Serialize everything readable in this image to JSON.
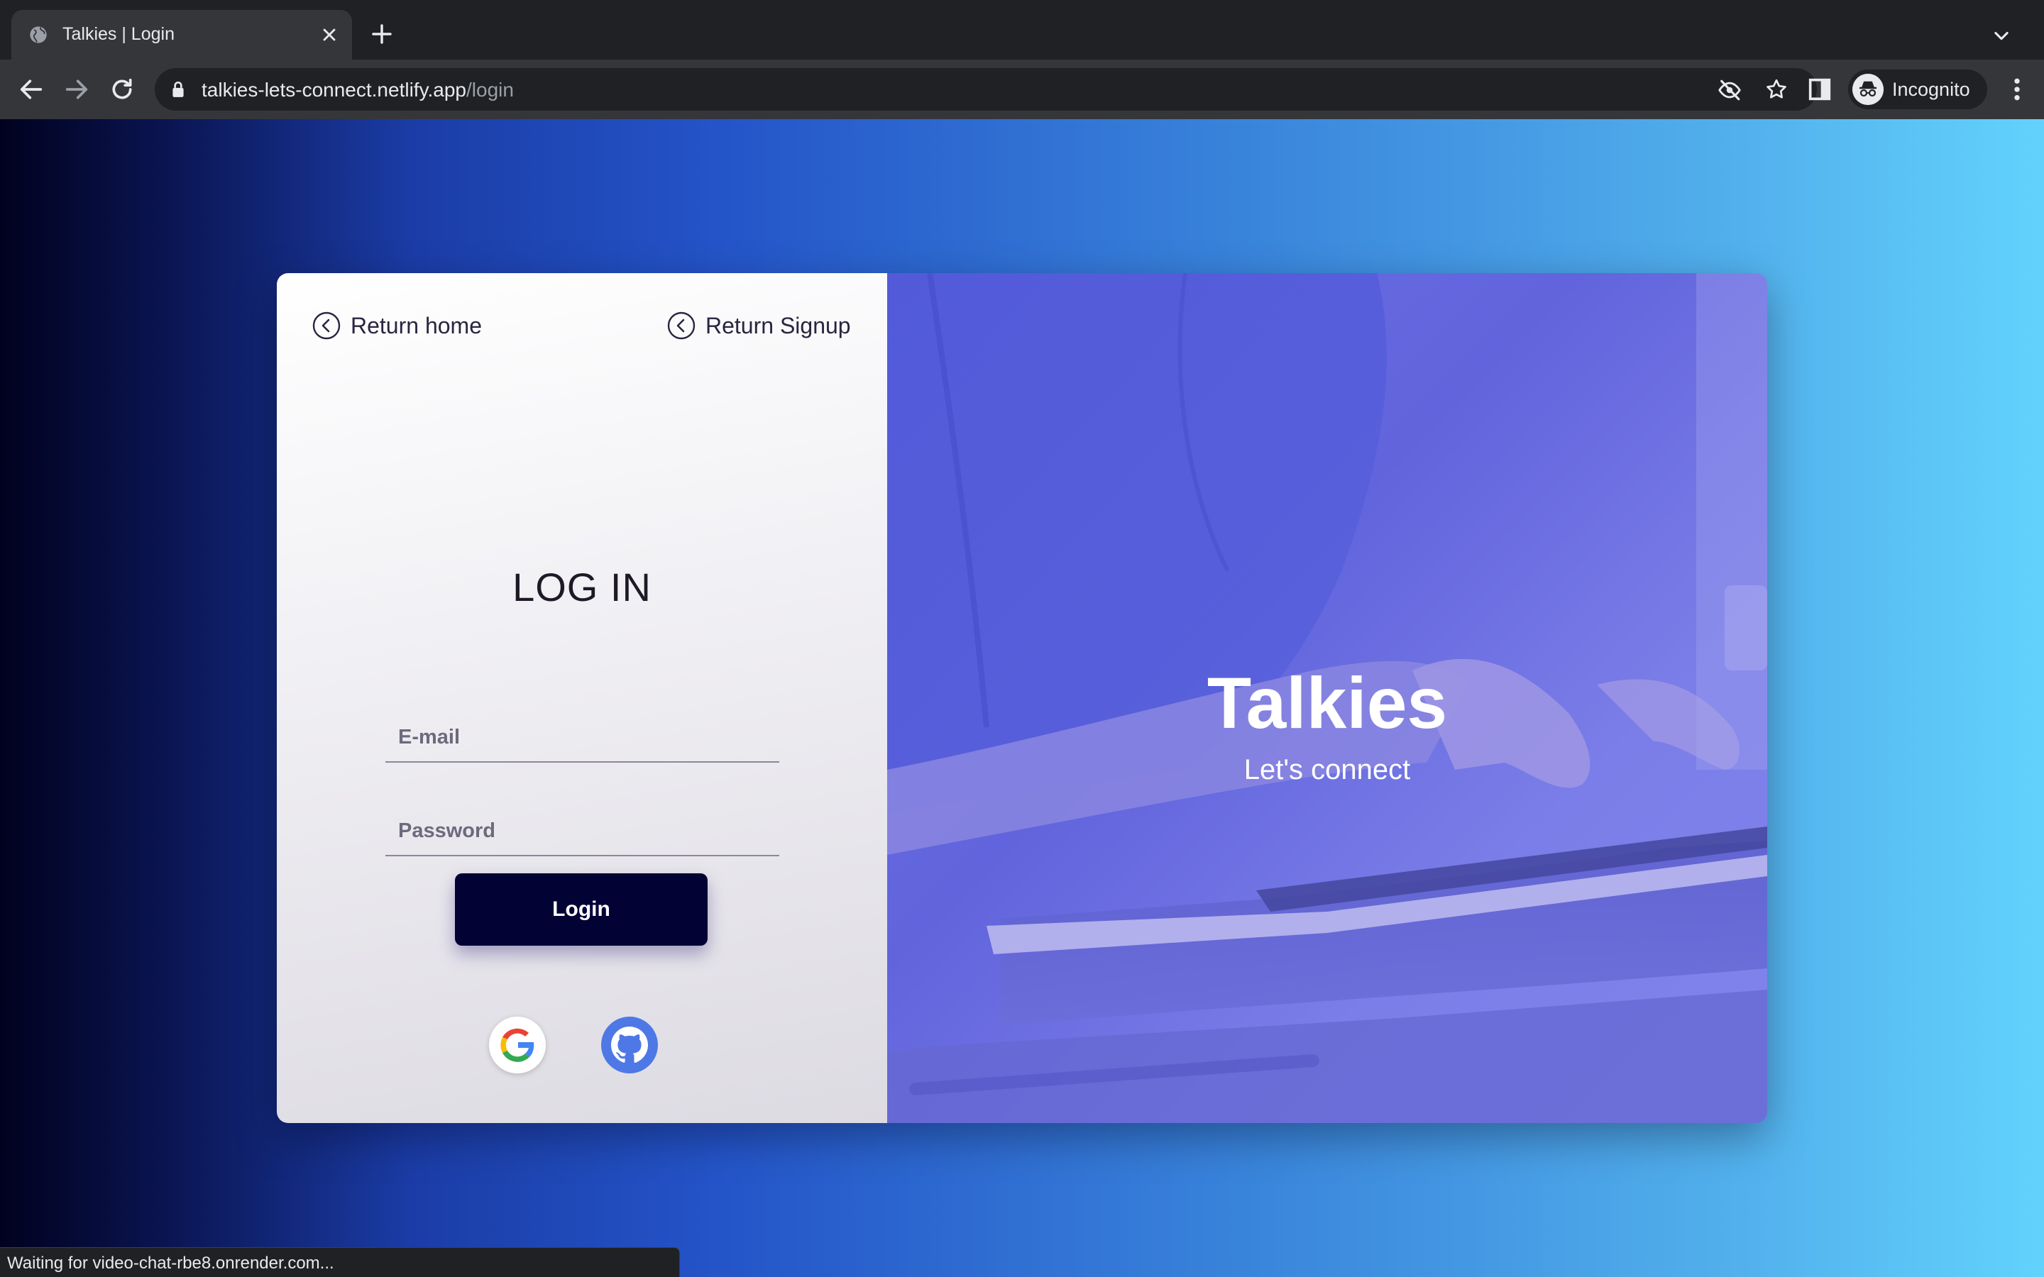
{
  "browser": {
    "tab_title": "Talkies | Login",
    "url_host": "talkies-lets-connect.netlify.app",
    "url_path": "/login",
    "profile_label": "Incognito",
    "status_text": "Waiting for video-chat-rbe8.onrender.com..."
  },
  "login": {
    "return_home": "Return home",
    "return_signup": "Return Signup",
    "title": "LOG IN",
    "email_placeholder": "E-mail",
    "password_placeholder": "Password",
    "login_button": "Login",
    "social_providers": [
      "google",
      "github"
    ]
  },
  "hero": {
    "brand": "Talkies",
    "tagline": "Let's connect"
  },
  "colors": {
    "button_bg": "#030234",
    "hero_overlay": "#6e72e6",
    "github_blue": "#4e78e6"
  }
}
